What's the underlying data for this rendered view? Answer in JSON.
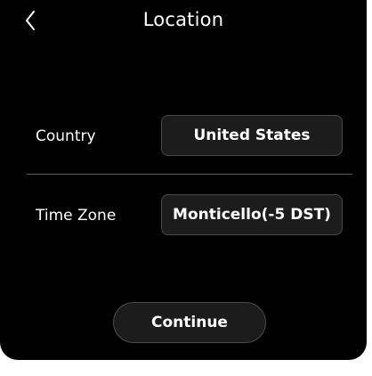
{
  "header": {
    "title": "Location",
    "back_icon": "chevron-left-icon"
  },
  "country": {
    "label": "Country",
    "value": "United States"
  },
  "timezone": {
    "label": "Time Zone",
    "value": "Monticello(-5 DST)"
  },
  "actions": {
    "continue_label": "Continue"
  },
  "colors": {
    "background": "#000000",
    "text": "#ffffff",
    "button_fill": "#1c1c1c",
    "button_border": "#4a4a4a",
    "divider": "#5a5a5a"
  }
}
